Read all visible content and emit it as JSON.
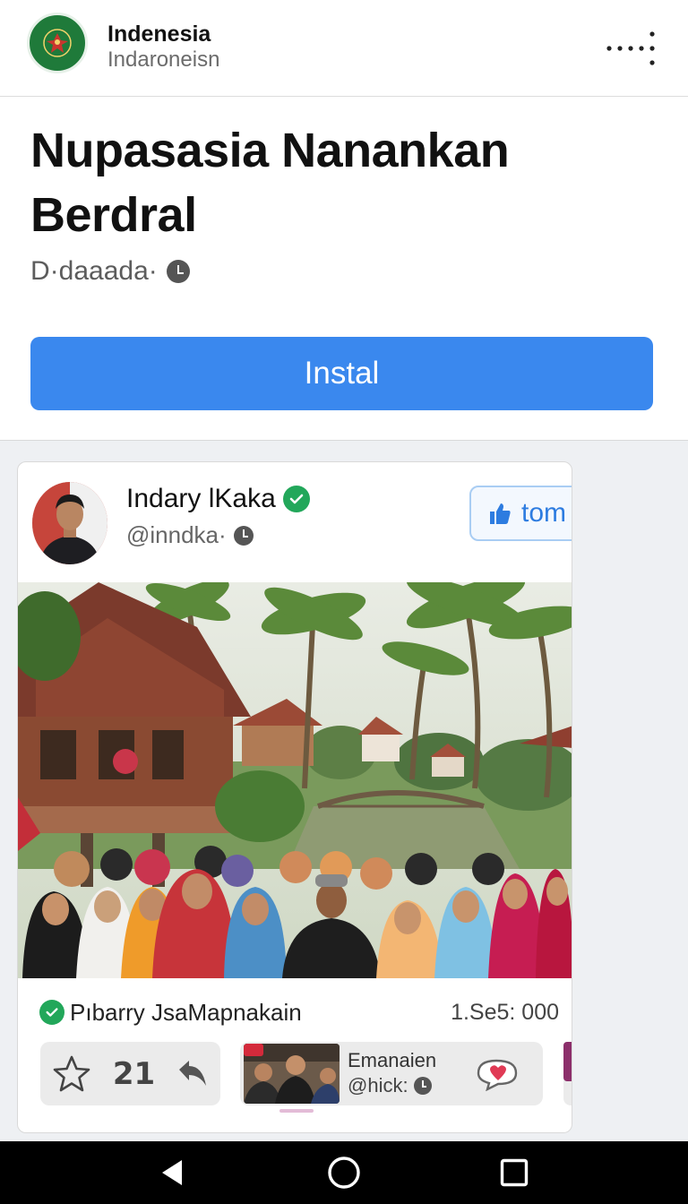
{
  "header": {
    "app_name": "Indenesia",
    "app_subname": "Indaroneisn",
    "logo_icon": "emblem-icon",
    "menu_icon": "more-dots-icon"
  },
  "hero": {
    "title": "Nupasasia Nanankan Berdral",
    "meta": "D·daaada·",
    "install_label": "Instal"
  },
  "post": {
    "author_name": "Indary lKaka",
    "author_handle": "@inndka·",
    "follow_label": "tom",
    "caption": "Pıbarry JsaMapnakain",
    "count": "1.Se5: 000",
    "action_count": "21",
    "related": {
      "name": "Emanaien",
      "handle": "@hick:"
    }
  },
  "colors": {
    "accent": "#3a88ee",
    "verified": "#22a75a",
    "logo": "#1f7a3a",
    "nav_bar": "#000000"
  }
}
